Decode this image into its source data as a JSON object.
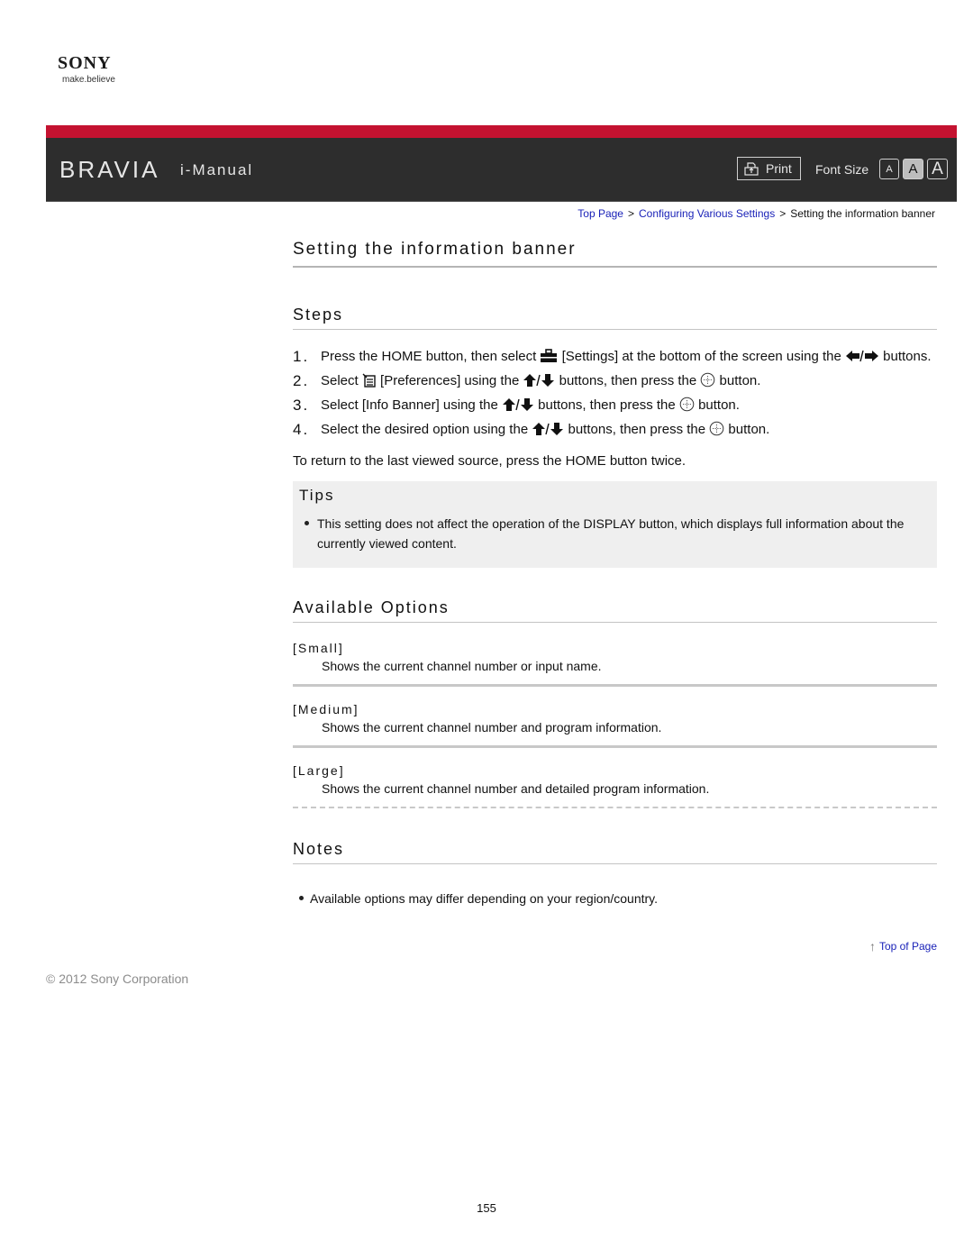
{
  "brand": {
    "company": "SONY",
    "tagline": "make.believe"
  },
  "header": {
    "product": "BRAVIA",
    "manual": "i-Manual",
    "print_label": "Print",
    "font_size_label": "Font Size",
    "font_size_options": [
      "A",
      "A",
      "A"
    ],
    "font_size_selected": "medium",
    "colors": {
      "accent_red": "#c41230",
      "bar": "#2d2d2d"
    }
  },
  "breadcrumb": {
    "items": [
      {
        "label": "Top Page",
        "link": true
      },
      {
        "label": "Configuring Various Settings",
        "link": true
      },
      {
        "label": "Setting the information banner",
        "link": false
      }
    ],
    "separator": ">"
  },
  "page": {
    "title": "Setting the information banner",
    "steps_heading": "Steps",
    "steps": [
      {
        "num": "1.",
        "a": "Press the HOME button, then select ",
        "icon": "toolbox-icon",
        "b": " [Settings] at the bottom of the screen using the ",
        "arrows": "left-right",
        "c": " buttons."
      },
      {
        "num": "2.",
        "a": "Select ",
        "icon": "preferences-icon",
        "b": " [Preferences] using the ",
        "arrows": "up-down",
        "c": " buttons, then press the ",
        "enter": true,
        "d": " button."
      },
      {
        "num": "3.",
        "a": "Select [Info Banner] using the ",
        "arrows": "up-down",
        "c": " buttons, then press the ",
        "enter": true,
        "d": " button."
      },
      {
        "num": "4.",
        "a": "Select the desired option using the ",
        "arrows": "up-down",
        "c": " buttons, then press the ",
        "enter": true,
        "d": " button."
      }
    ],
    "return_text": "To return to the last viewed source, press the HOME button twice.",
    "tips": {
      "heading": "Tips",
      "items": [
        "This setting does not affect the operation of the DISPLAY button, which displays full information about the currently viewed content."
      ]
    },
    "options": {
      "heading": "Available Options",
      "items": [
        {
          "name": "[Small]",
          "desc": "Shows the current channel number or input name."
        },
        {
          "name": "[Medium]",
          "desc": "Shows the current channel number and program information."
        },
        {
          "name": "[Large]",
          "desc": "Shows the current channel number and detailed program information."
        }
      ]
    },
    "notes": {
      "heading": "Notes",
      "items": [
        "Available options may differ depending on your region/country."
      ]
    },
    "top_of_page": "Top of Page"
  },
  "footer": {
    "copyright": "© 2012 Sony Corporation",
    "page_number": "155"
  }
}
